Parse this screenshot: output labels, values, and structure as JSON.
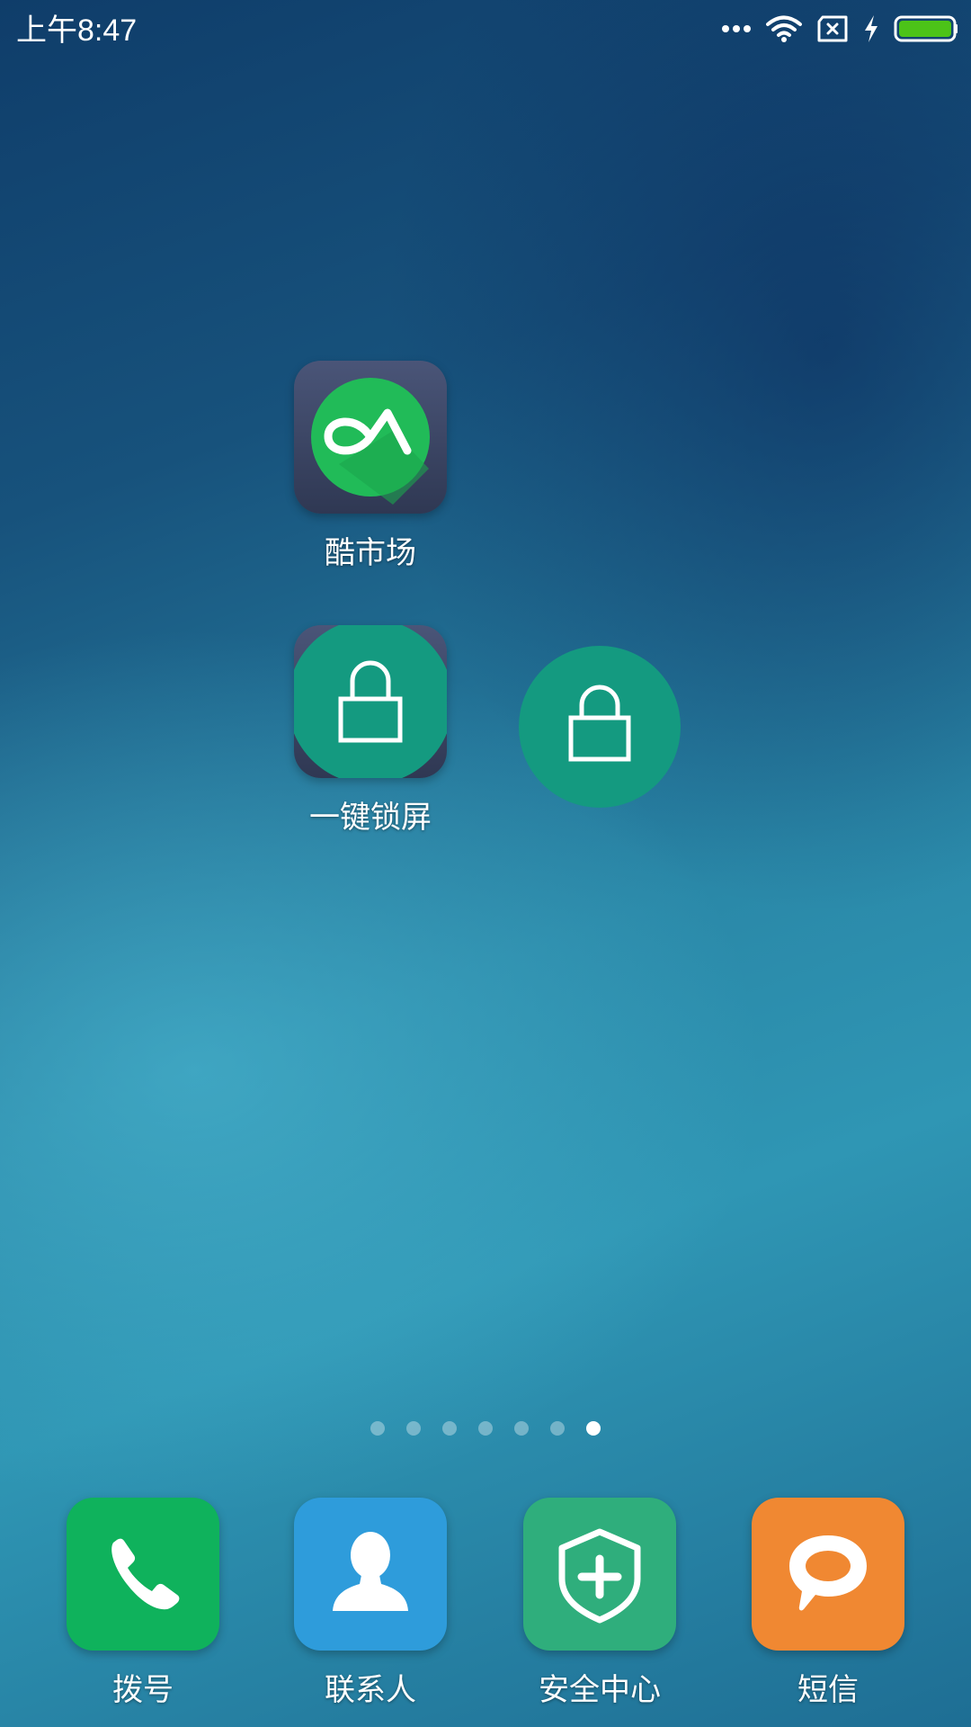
{
  "status_bar": {
    "time": "上午8:47",
    "icons": [
      "more-dots-icon",
      "wifi-icon",
      "no-sim-icon",
      "charging-icon",
      "battery-icon"
    ],
    "battery_color": "#4cc318"
  },
  "home_apps": [
    {
      "label": "酷市场",
      "icon": "coolmarket-icon"
    },
    {
      "label": "一键锁屏",
      "icon": "lock-icon"
    }
  ],
  "floating_widget": {
    "icon": "lock-icon",
    "color": "#149a80"
  },
  "page_indicator": {
    "total": 7,
    "active": 7
  },
  "dock": [
    {
      "label": "拨号",
      "icon": "phone-icon",
      "color": "#0fb25c"
    },
    {
      "label": "联系人",
      "icon": "contact-icon",
      "color": "#2e9cdb"
    },
    {
      "label": "安全中心",
      "icon": "shield-plus-icon",
      "color": "#2fae7c"
    },
    {
      "label": "短信",
      "icon": "message-icon",
      "color": "#f08832"
    }
  ]
}
